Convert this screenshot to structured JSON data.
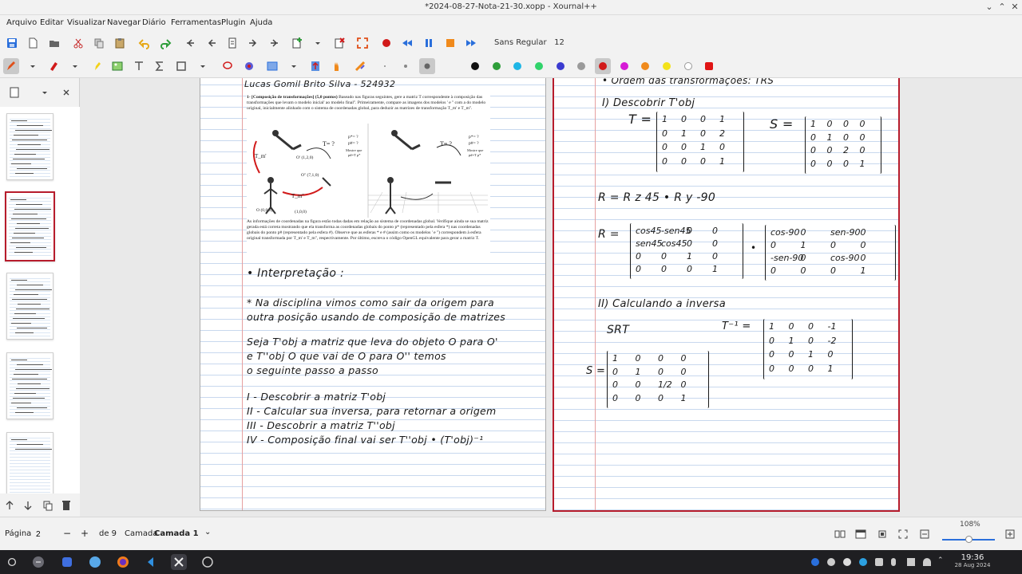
{
  "window": {
    "title": "*2024-08-27-Nota-21-30.xopp - Xournal++"
  },
  "menu": [
    "Arquivo",
    "Editar",
    "Visualizar",
    "Navegar",
    "Diário",
    "Ferramentas",
    "Plugin",
    "Ajuda"
  ],
  "toolbar": {
    "font": "Sans Regular",
    "font_size": "12"
  },
  "colors": {
    "accent": "#b71c2c",
    "palette": [
      "#111111",
      "#2e9e3a",
      "#1eb6e6",
      "#31d36b",
      "#3b3bd0",
      "#9a9a9a",
      "#d11a1a",
      "#d61bd6",
      "#f08a1c",
      "#f3e21a",
      "#ffffff",
      "#e01515"
    ]
  },
  "page1": {
    "header": "Lucas Gomil Brito Silva - 524932",
    "pdf_heading": "1- [Composição de transformações] (5,0 pontos)",
    "pdf_para1": "Baseado nas figuras seguintes, gere a matriz T correspondente à composição das transformações que levam o modelo inicial' ao modelo final''. Primeiramente, compare as imagens dos modelos ' e '' com a do modelo original, inicialmente alinhado com o sistema de coordenadas global, para deduzir as matrizes de transformação T_m' e T_m''.",
    "pdf_fig_labels": [
      "T= ?",
      "p*= ?",
      "p#= ?",
      "Mostre que",
      "p#=T p*",
      "T= ?",
      "p*= ?",
      "p#= ?",
      "Mostre que",
      "p#=T p*",
      "O' (1,2,0)",
      "O'' (7,1,0)",
      "O (0,0,0)",
      "(1,0,0)",
      "T_m''",
      "T_m'"
    ],
    "pdf_para2": "As informações de coordenadas na figura estão todas dadas em relação ao sistema de coordenadas global. Verifique ainda se sua matriz gerada está correta mostrando que ela transforma as coordenadas globais do ponto p* (representado pela esfera *) nas coordenadas globais do ponto p# (representado pela esfera #). Observe que as esferas * e # (assim como os modelos ' e '') correspondem à esfera original transformada por T_m' e T_m'', respectivamente. Por último, escreva o código OpenGL equivalente para gerar a matriz T.",
    "hw_lines": [
      "• Interpretação :",
      "* Na disciplina vimos como sair da origem para",
      "outra posição usando de composição de matrizes",
      "Seja T'obj a matriz que leva do objeto O para O'",
      "e T''obj O que vai de O para O'' temos",
      "o seguinte passo a passo",
      "I - Descobrir a matriz T'obj",
      "II - Calcular sua inversa, para retornar a origem",
      "III - Descobrir a matriz T''obj",
      "IV - Composição final vai ser T''obj • (T'obj)⁻¹"
    ]
  },
  "page2": {
    "top_line": "• Ordem das transformações: TRS",
    "section1": "I) Descobrir T'obj",
    "T_label": "T =",
    "T_matrix": [
      [
        "1",
        "0",
        "0",
        "1"
      ],
      [
        "0",
        "1",
        "0",
        "2"
      ],
      [
        "0",
        "0",
        "1",
        "0"
      ],
      [
        "0",
        "0",
        "0",
        "1"
      ]
    ],
    "S_label": "S =",
    "S_matrix": [
      [
        "1",
        "0",
        "0",
        "0"
      ],
      [
        "0",
        "1",
        "0",
        "0"
      ],
      [
        "0",
        "0",
        "2",
        "0"
      ],
      [
        "0",
        "0",
        "0",
        "1"
      ]
    ],
    "R_def": "R = R z 45 • R y -90",
    "R_label": "R =",
    "Rz_matrix": [
      [
        "cos45",
        "-sen45",
        "0",
        "0"
      ],
      [
        "sen45",
        "cos45",
        "0",
        "0"
      ],
      [
        "0",
        "0",
        "1",
        "0"
      ],
      [
        "0",
        "0",
        "0",
        "1"
      ]
    ],
    "Ry_matrix": [
      [
        "cos-90",
        "0",
        "sen-90",
        "0"
      ],
      [
        "0",
        "1",
        "0",
        "0"
      ],
      [
        "-sen-90",
        "0",
        "cos-90",
        "0"
      ],
      [
        "0",
        "0",
        "0",
        "1"
      ]
    ],
    "section2": "II) Calculando a inversa",
    "srt": "SRT",
    "inv_S_label": "S =",
    "inv_S_matrix": [
      [
        "1",
        "0",
        "0",
        "0"
      ],
      [
        "0",
        "1",
        "0",
        "0"
      ],
      [
        "0",
        "0",
        "1/2",
        "0"
      ],
      [
        "0",
        "0",
        "0",
        "1"
      ]
    ],
    "T_inv_label": "T⁻¹ =",
    "T_inv_matrix": [
      [
        "1",
        "0",
        "0",
        "-1"
      ],
      [
        "0",
        "1",
        "0",
        "-2"
      ],
      [
        "0",
        "0",
        "1",
        "0"
      ],
      [
        "0",
        "0",
        "0",
        "1"
      ]
    ]
  },
  "status": {
    "page_label": "Página",
    "page_value": "2",
    "of_label": "de 9",
    "layer_label": "Camada",
    "layer_value": "Camada 1",
    "zoom": "108%"
  },
  "taskbar": {
    "time": "19:36",
    "date": "28 Aug 2024"
  }
}
